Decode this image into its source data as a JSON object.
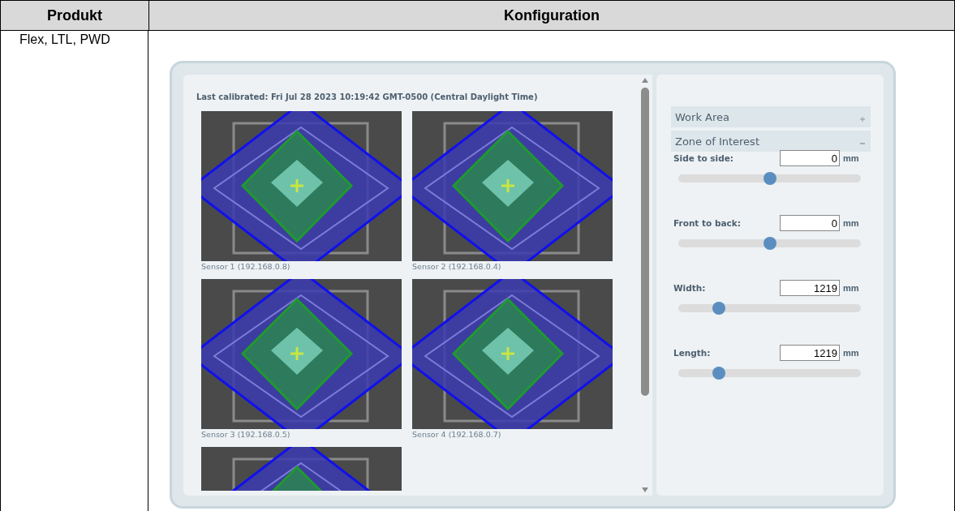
{
  "table": {
    "columns": [
      "Produkt",
      "Konfiguration"
    ],
    "rows": [
      {
        "product": "Flex, LTL, PWD"
      }
    ]
  },
  "calibration": {
    "last_calibrated": "Last calibrated: Fri Jul 28 2023 10:19:42 GMT-0500 (Central Daylight Time)",
    "sensors": [
      {
        "label": "Sensor 1 (192.168.0.8)",
        "cut_off": false
      },
      {
        "label": "Sensor 2 (192.168.0.4)",
        "cut_off": false
      },
      {
        "label": "Sensor 3 (192.168.0.5)",
        "cut_off": false
      },
      {
        "label": "Sensor 4 (192.168.0.7)",
        "cut_off": false
      },
      {
        "cut_off": true
      }
    ]
  },
  "settings": {
    "sections": [
      {
        "title": "Work Area",
        "expanded": false
      },
      {
        "title": "Zone of Interest",
        "expanded": true
      }
    ],
    "fields": [
      {
        "label": "Side to side:",
        "value": "0",
        "unit": "mm",
        "level": 0.5
      },
      {
        "label": "Front to back:",
        "value": "0",
        "unit": "mm",
        "level": 0.5
      },
      {
        "label": "Width:",
        "value": "1219",
        "unit": "mm",
        "level": 0.22
      },
      {
        "label": "Length:",
        "value": "1219",
        "unit": "mm",
        "level": 0.22
      }
    ]
  }
}
